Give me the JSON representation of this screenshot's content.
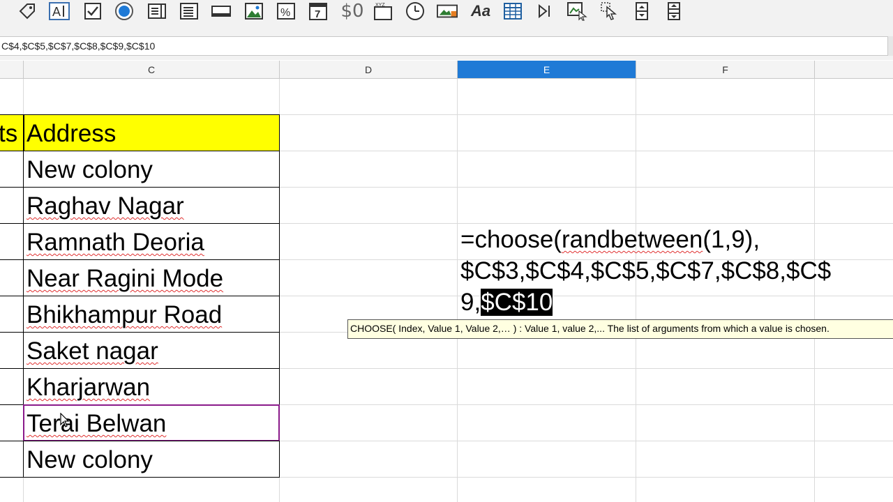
{
  "toolbar": {
    "icons": [
      "tag-icon",
      "text-field-icon",
      "checkbox-icon",
      "radio-button-icon",
      "list-box-icon",
      "combo-box-icon",
      "push-button-icon",
      "image-control-icon",
      "percent-field-icon",
      "date-field-icon",
      "currency-field-icon",
      "numeric-field-icon",
      "time-field-icon",
      "image-button-icon",
      "formatted-field-icon",
      "table-control-icon",
      "navigation-bar-icon",
      "group-box-icon",
      "pointer-icon",
      "spin-button-icon",
      "scrollbar-icon"
    ],
    "currency_glyph": "$0",
    "font_glyph": "Aa",
    "date_glyph": "7"
  },
  "formula_bar": {
    "value": "C$4,$C$5,$C$7,$C$8,$C$9,$C$10"
  },
  "columns": [
    {
      "id": "C",
      "label": "C"
    },
    {
      "id": "D",
      "label": "D"
    },
    {
      "id": "E",
      "label": "E"
    },
    {
      "id": "F",
      "label": "F"
    }
  ],
  "column_b_partial": "ts",
  "header_cell": "Address",
  "addresses": [
    "New colony",
    "Raghav Nagar",
    "Ramnath Deoria",
    "Near Ragini Mode",
    "Bhikhampur Road",
    "Saket nagar",
    "Kharjarwan",
    "Terai Belwan",
    "New colony"
  ],
  "cell_edit": {
    "line1_a": "=choose(",
    "line1_b": "randbetween",
    "line1_c": "(1,9),",
    "line2": "$C$3,$C$4,$C$5,$C$7,$C$8,$C$",
    "line3_plain": "9,",
    "line3_selected": "$C$10"
  },
  "tooltip": "CHOOSE( Index, Value 1, Value 2,… ) : Value 1, value 2,... The list of arguments from which a value is chosen.",
  "colors": {
    "header_fill": "#ffff00",
    "selected_column": "#1f7ad6",
    "active_cell_border": "#8a1a8a",
    "tooltip_bg": "#ffffe1"
  }
}
